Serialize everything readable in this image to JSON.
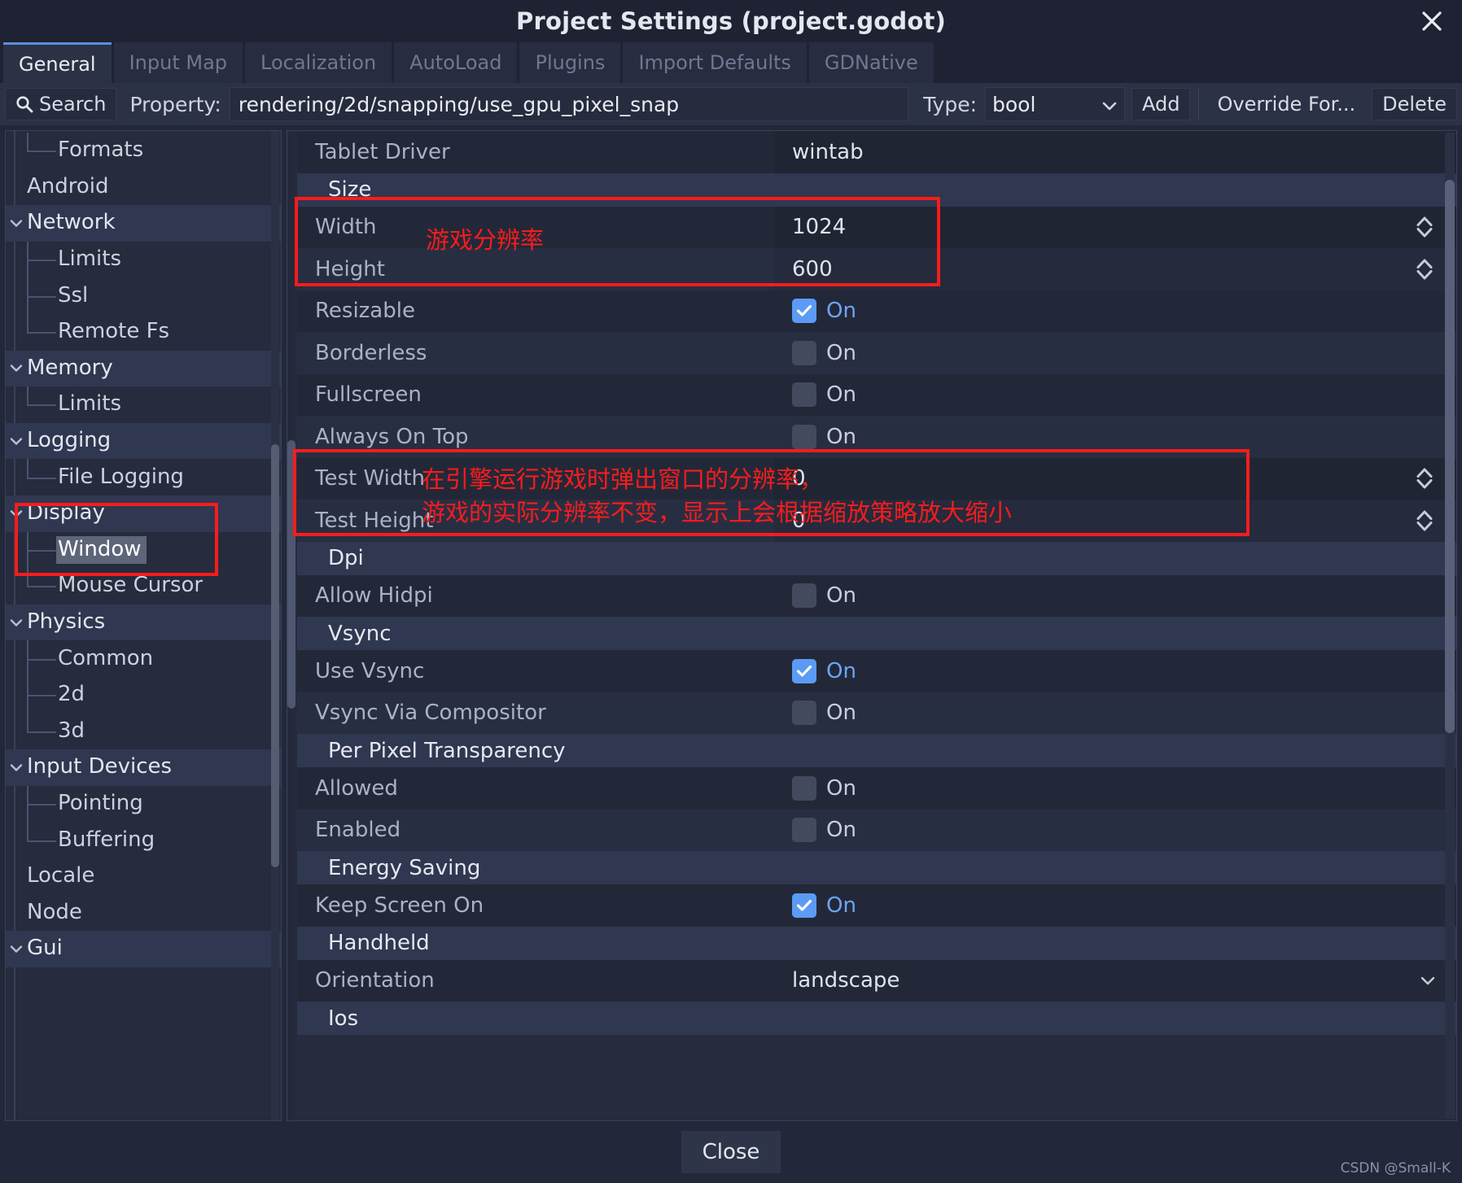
{
  "window": {
    "title": "Project Settings (project.godot)",
    "close_icon": "close-x-icon"
  },
  "tabs": [
    {
      "label": "General",
      "active": true
    },
    {
      "label": "Input Map",
      "active": false
    },
    {
      "label": "Localization",
      "active": false
    },
    {
      "label": "AutoLoad",
      "active": false
    },
    {
      "label": "Plugins",
      "active": false
    },
    {
      "label": "Import Defaults",
      "active": false
    },
    {
      "label": "GDNative",
      "active": false
    }
  ],
  "toolbar": {
    "search_label": "Search",
    "search_icon": "magnifier-icon",
    "property_label": "Property:",
    "property_value": "rendering/2d/snapping/use_gpu_pixel_snap",
    "type_label": "Type:",
    "type_value": "bool",
    "type_caret_icon": "chevron-down-icon",
    "add_label": "Add",
    "override_label": "Override For...",
    "delete_label": "Delete"
  },
  "sidebar": {
    "items": [
      {
        "label": "Formats",
        "kind": "child",
        "last": true,
        "selected": false
      },
      {
        "label": "Android",
        "kind": "root",
        "last": false,
        "selected": false
      },
      {
        "label": "Network",
        "kind": "category",
        "last": false,
        "selected": false
      },
      {
        "label": "Limits",
        "kind": "child",
        "last": false,
        "selected": false
      },
      {
        "label": "Ssl",
        "kind": "child",
        "last": false,
        "selected": false
      },
      {
        "label": "Remote Fs",
        "kind": "child",
        "last": true,
        "selected": false
      },
      {
        "label": "Memory",
        "kind": "category",
        "last": false,
        "selected": false
      },
      {
        "label": "Limits",
        "kind": "child",
        "last": true,
        "selected": false
      },
      {
        "label": "Logging",
        "kind": "category",
        "last": false,
        "selected": false
      },
      {
        "label": "File Logging",
        "kind": "child",
        "last": true,
        "selected": false
      },
      {
        "label": "Display",
        "kind": "category",
        "last": false,
        "selected": false
      },
      {
        "label": "Window",
        "kind": "child",
        "last": false,
        "selected": true
      },
      {
        "label": "Mouse Cursor",
        "kind": "child",
        "last": true,
        "selected": false
      },
      {
        "label": "Physics",
        "kind": "category",
        "last": false,
        "selected": false
      },
      {
        "label": "Common",
        "kind": "child",
        "last": false,
        "selected": false
      },
      {
        "label": "2d",
        "kind": "child",
        "last": false,
        "selected": false
      },
      {
        "label": "3d",
        "kind": "child",
        "last": true,
        "selected": false
      },
      {
        "label": "Input Devices",
        "kind": "category",
        "last": false,
        "selected": false
      },
      {
        "label": "Pointing",
        "kind": "child",
        "last": false,
        "selected": false
      },
      {
        "label": "Buffering",
        "kind": "child",
        "last": true,
        "selected": false
      },
      {
        "label": "Locale",
        "kind": "root",
        "last": false,
        "selected": false
      },
      {
        "label": "Node",
        "kind": "root",
        "last": false,
        "selected": false
      },
      {
        "label": "Gui",
        "kind": "category",
        "last": false,
        "selected": false
      }
    ],
    "expand_icon": "chevron-down-icon"
  },
  "properties": [
    {
      "name": "Tablet Driver",
      "type": "text",
      "value": "wintab",
      "section": false,
      "shaded": false
    },
    {
      "name": "Size",
      "type": "section",
      "value": "",
      "section": true,
      "shaded": true
    },
    {
      "name": "Width",
      "type": "number",
      "value": "1024",
      "section": false,
      "shaded": false
    },
    {
      "name": "Height",
      "type": "number",
      "value": "600",
      "section": false,
      "shaded": true
    },
    {
      "name": "Resizable",
      "type": "checkbox",
      "value": "On",
      "checked": true,
      "section": false,
      "shaded": false
    },
    {
      "name": "Borderless",
      "type": "checkbox",
      "value": "On",
      "checked": false,
      "section": false,
      "shaded": true
    },
    {
      "name": "Fullscreen",
      "type": "checkbox",
      "value": "On",
      "checked": false,
      "section": false,
      "shaded": false
    },
    {
      "name": "Always On Top",
      "type": "checkbox",
      "value": "On",
      "checked": false,
      "section": false,
      "shaded": true
    },
    {
      "name": "Test Width",
      "type": "number",
      "value": "0",
      "section": false,
      "shaded": false
    },
    {
      "name": "Test Height",
      "type": "number",
      "value": "0",
      "section": false,
      "shaded": true
    },
    {
      "name": "Dpi",
      "type": "section",
      "value": "",
      "section": true,
      "shaded": true
    },
    {
      "name": "Allow Hidpi",
      "type": "checkbox",
      "value": "On",
      "checked": false,
      "section": false,
      "shaded": false
    },
    {
      "name": "Vsync",
      "type": "section",
      "value": "",
      "section": true,
      "shaded": true
    },
    {
      "name": "Use Vsync",
      "type": "checkbox",
      "value": "On",
      "checked": true,
      "section": false,
      "shaded": false
    },
    {
      "name": "Vsync Via Compositor",
      "type": "checkbox",
      "value": "On",
      "checked": false,
      "section": false,
      "shaded": true
    },
    {
      "name": "Per Pixel Transparency",
      "type": "section",
      "value": "",
      "section": true,
      "shaded": true
    },
    {
      "name": "Allowed",
      "type": "checkbox",
      "value": "On",
      "checked": false,
      "section": false,
      "shaded": false
    },
    {
      "name": "Enabled",
      "type": "checkbox",
      "value": "On",
      "checked": false,
      "section": false,
      "shaded": true
    },
    {
      "name": "Energy Saving",
      "type": "section",
      "value": "",
      "section": true,
      "shaded": true
    },
    {
      "name": "Keep Screen On",
      "type": "checkbox",
      "value": "On",
      "checked": true,
      "section": false,
      "shaded": false
    },
    {
      "name": "Handheld",
      "type": "section",
      "value": "",
      "section": true,
      "shaded": true
    },
    {
      "name": "Orientation",
      "type": "dropdown",
      "value": "landscape",
      "section": false,
      "shaded": false
    },
    {
      "name": "Ios",
      "type": "section",
      "value": "",
      "section": true,
      "shaded": true
    }
  ],
  "annotations": {
    "resolution_note": "游戏分辨率",
    "test_note_line1": "在引擎运行游戏时弹出窗口的分辨率，",
    "test_note_line2": "游戏的实际分辨率不变，显示上会根据缩放策略放大缩小",
    "color": "#f91c1c"
  },
  "footer": {
    "close_label": "Close",
    "watermark": "CSDN @Small-K"
  }
}
